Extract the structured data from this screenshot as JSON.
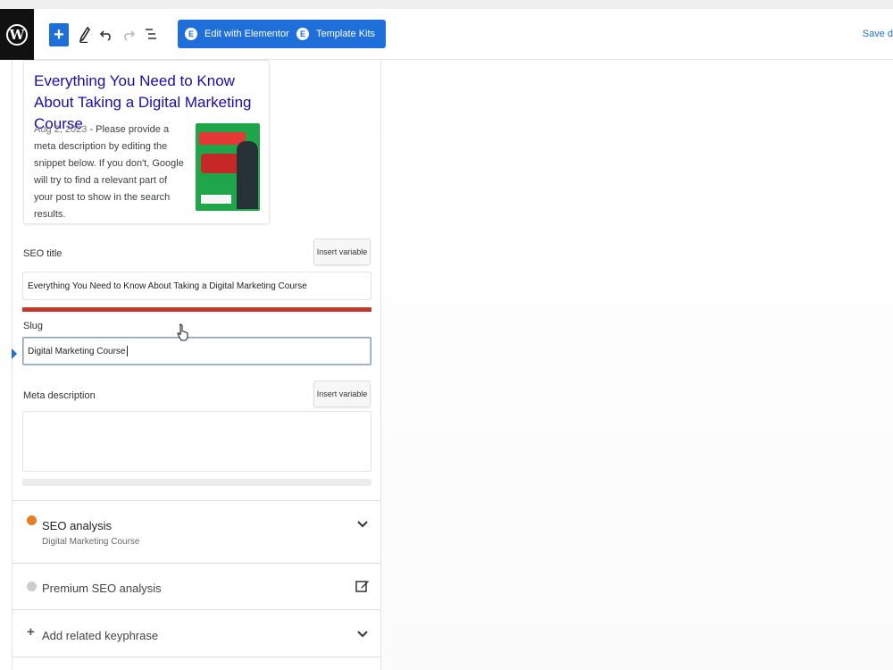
{
  "toolbar": {
    "edit_elementor_label": "Edit with Elementor",
    "template_kits_label": "Template Kits",
    "save_label": "Save d"
  },
  "snippet": {
    "title": "Everything You Need to Know About Taking a Digital Marketing Course",
    "date": "Aug 2, 2023",
    "separator": " - ",
    "description": "Please provide a meta description by editing the snippet below. If you don't, Google will try to find a relevant part of your post to show in the search results."
  },
  "seo_title": {
    "label": "SEO title",
    "insert_variable": "Insert variable",
    "value": "Everything You Need to Know About Taking a Digital Marketing Course",
    "progress": 1.0
  },
  "slug": {
    "label": "Slug",
    "value": "Digital Marketing Course"
  },
  "meta_description": {
    "label": "Meta description",
    "insert_variable": "Insert variable",
    "value": ""
  },
  "panels": {
    "seo_analysis": {
      "title": "SEO analysis",
      "subtitle": "Digital Marketing Course",
      "status_color": "#e67e22"
    },
    "premium_seo": {
      "title": "Premium SEO analysis",
      "status_color": "#cccccc"
    },
    "related_keyphrase": {
      "title": "Add related keyphrase"
    }
  },
  "colors": {
    "accent": "#1e6fd9",
    "title_bar": "#c0392b"
  }
}
